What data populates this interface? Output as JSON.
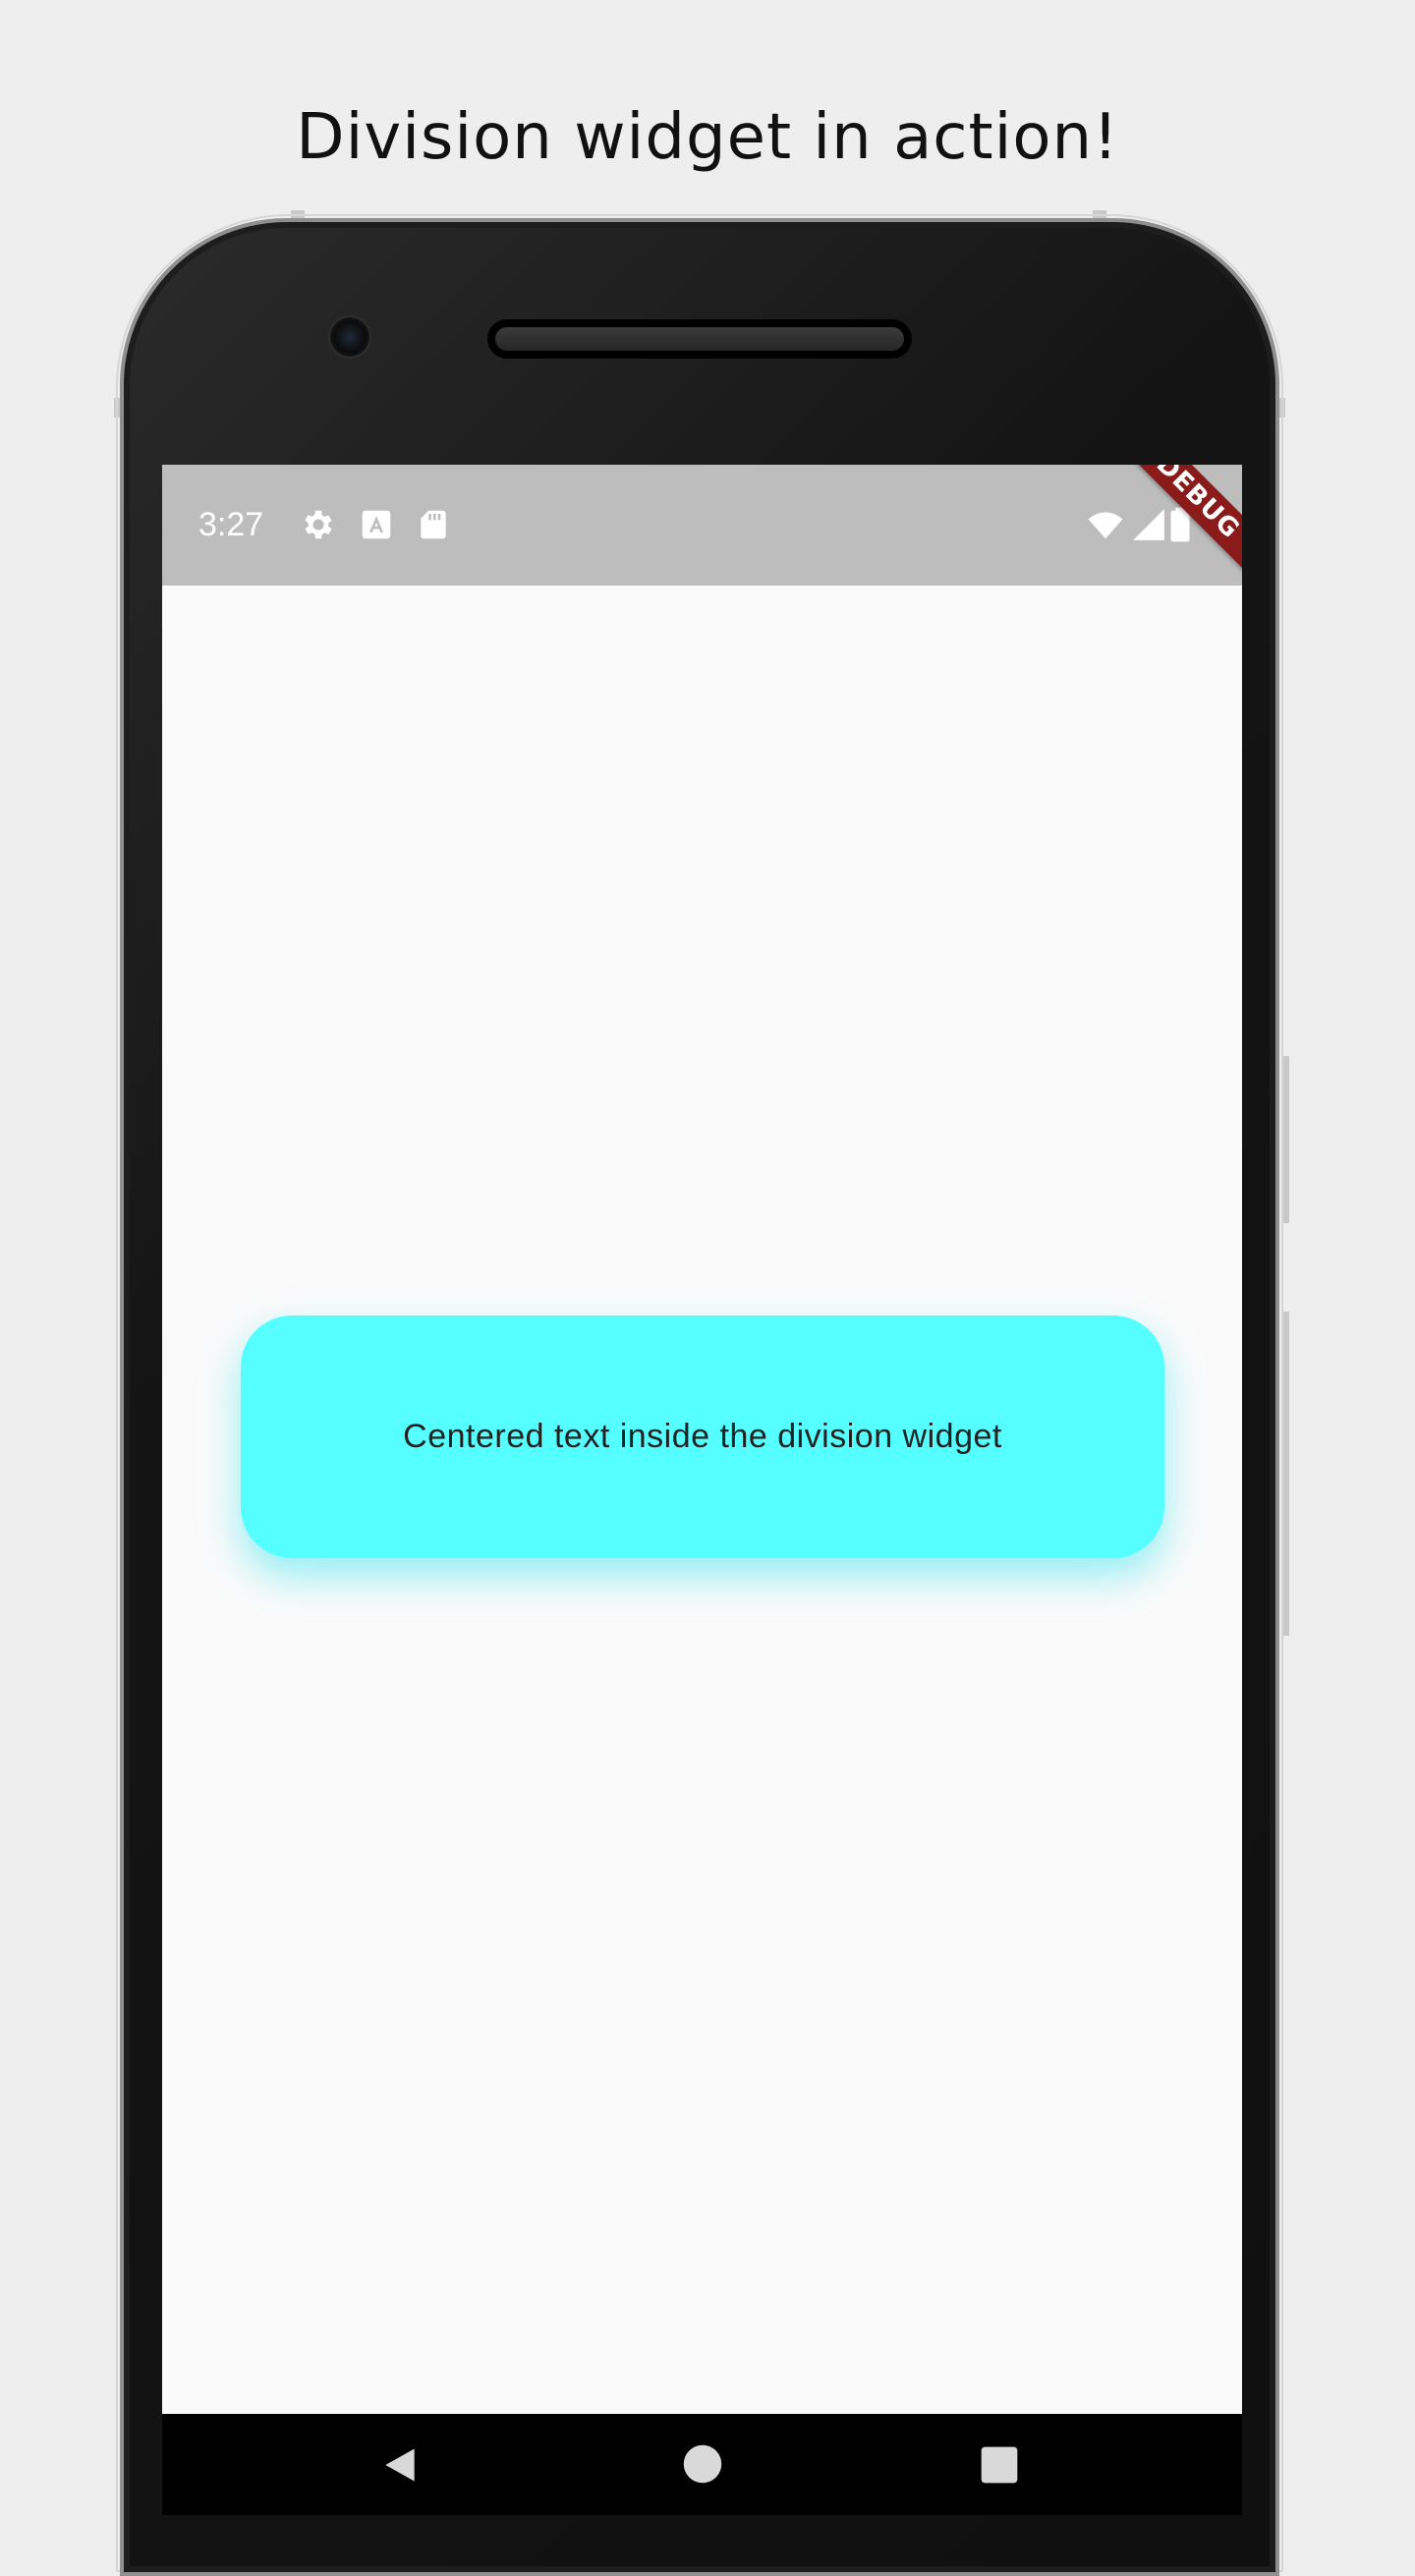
{
  "caption": "Division widget in action!",
  "status_bar": {
    "time": "3:27",
    "left_icons": [
      "gear-icon",
      "a-box-icon",
      "sd-card-icon"
    ],
    "right_icons": [
      "wifi-icon",
      "signal-icon",
      "battery-icon"
    ],
    "background": "#bdbdbd"
  },
  "debug_banner": "DEBUG",
  "division": {
    "text": "Centered text inside the division widget",
    "background": "#55ffff"
  },
  "nav_bar": {
    "buttons": [
      "back-icon",
      "home-icon",
      "recents-icon"
    ]
  }
}
